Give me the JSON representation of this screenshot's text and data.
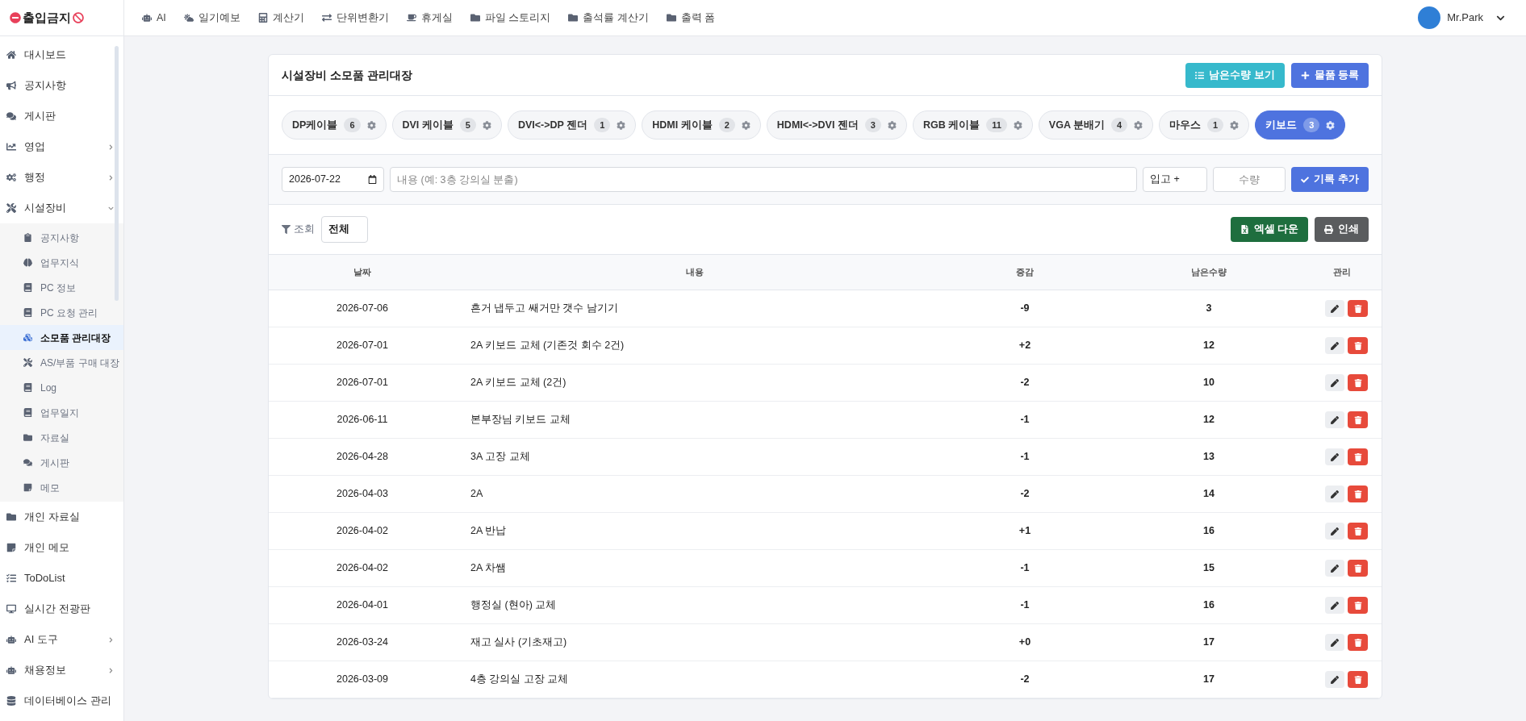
{
  "brand": {
    "title": "출입금지"
  },
  "sidebar": {
    "items": [
      {
        "label": "대시보드",
        "kind": "item"
      },
      {
        "label": "공지사항",
        "kind": "item"
      },
      {
        "label": "게시판",
        "kind": "item"
      },
      {
        "label": "영업",
        "kind": "group",
        "expanded": false
      },
      {
        "label": "행정",
        "kind": "group",
        "expanded": false
      },
      {
        "label": "시설장비",
        "kind": "group",
        "expanded": true,
        "children": [
          {
            "label": "공지사항",
            "selected": false
          },
          {
            "label": "업무지식",
            "selected": false
          },
          {
            "label": "PC 정보",
            "selected": false
          },
          {
            "label": "PC 요청 관리",
            "selected": false
          },
          {
            "label": "소모품 관리대장",
            "selected": true
          },
          {
            "label": "AS/부품 구매 대장",
            "selected": false
          },
          {
            "label": "Log",
            "selected": false
          },
          {
            "label": "업무일지",
            "selected": false
          },
          {
            "label": "자료실",
            "selected": false
          },
          {
            "label": "게시판",
            "selected": false
          },
          {
            "label": "메모",
            "selected": false
          }
        ]
      },
      {
        "label": "개인 자료실",
        "kind": "item"
      },
      {
        "label": "개인 메모",
        "kind": "item"
      },
      {
        "label": "ToDoList",
        "kind": "item"
      },
      {
        "label": "실시간 전광판",
        "kind": "item"
      },
      {
        "label": "AI 도구",
        "kind": "group",
        "expanded": false
      },
      {
        "label": "채용정보",
        "kind": "group",
        "expanded": false
      },
      {
        "label": "데이터베이스 관리",
        "kind": "item"
      }
    ]
  },
  "top_nav": [
    {
      "label": "AI"
    },
    {
      "label": "일기예보"
    },
    {
      "label": "계산기"
    },
    {
      "label": "단위변환기"
    },
    {
      "label": "휴게실"
    },
    {
      "label": "파일 스토리지"
    },
    {
      "label": "출석률 계산기"
    },
    {
      "label": "출력 폼"
    }
  ],
  "user": {
    "name": "Mr.Park"
  },
  "card": {
    "title": "시설장비 소모품 관리대장",
    "buttons": [
      {
        "label": "남은수량 보기",
        "kind": "info"
      },
      {
        "label": "물품 등록",
        "kind": "primary"
      }
    ]
  },
  "categories": [
    {
      "label": "DP케이블",
      "count": "6",
      "selected": false
    },
    {
      "label": "DVI 케이블",
      "count": "5",
      "selected": false
    },
    {
      "label": "DVI<->DP 젠더",
      "count": "1",
      "selected": false
    },
    {
      "label": "HDMI 케이블",
      "count": "2",
      "selected": false
    },
    {
      "label": "HDMI<->DVI 젠더",
      "count": "3",
      "selected": false
    },
    {
      "label": "RGB 케이블",
      "count": "11",
      "selected": false
    },
    {
      "label": "VGA 분배기",
      "count": "4",
      "selected": false
    },
    {
      "label": "마우스",
      "count": "1",
      "selected": false
    },
    {
      "label": "키보드",
      "count": "3",
      "selected": true
    }
  ],
  "entry_form": {
    "date": "2026-07-22",
    "content_placeholder": "내용 (예: 3층 강의실 분출)",
    "type": "입고 +",
    "quantity_placeholder": "수량",
    "submit": "기록 추가"
  },
  "filter": {
    "label": "조회",
    "value": "전체",
    "buttons": [
      {
        "label": "엑셀 다운",
        "kind": "excel"
      },
      {
        "label": "인쇄",
        "kind": "print"
      }
    ]
  },
  "table": {
    "columns": [
      "날짜",
      "내용",
      "증감",
      "남은수량",
      "관리"
    ],
    "rows": [
      [
        "2026-07-06",
        "흔거 냅두고 쌔거만 갯수 남기기",
        "-9",
        "3"
      ],
      [
        "2026-07-01",
        "2A 키보드 교체 (기존것 회수 2건)",
        "+2",
        "12"
      ],
      [
        "2026-07-01",
        "2A 키보드 교체 (2건)",
        "-2",
        "10"
      ],
      [
        "2026-06-11",
        "본부장님 키보드 교체",
        "-1",
        "12"
      ],
      [
        "2026-04-28",
        "3A 고장 교체",
        "-1",
        "13"
      ],
      [
        "2026-04-03",
        "2A",
        "-2",
        "14"
      ],
      [
        "2026-04-02",
        "2A 반납",
        "+1",
        "16"
      ],
      [
        "2026-04-02",
        "2A 차쌤",
        "-1",
        "15"
      ],
      [
        "2026-04-01",
        "행정실 (현아) 교체",
        "-1",
        "16"
      ],
      [
        "2026-03-24",
        "재고 실사 (기초재고)",
        "+0",
        "17"
      ],
      [
        "2026-03-09",
        "4층 강의실 고장 교체",
        "-2",
        "17"
      ]
    ]
  }
}
